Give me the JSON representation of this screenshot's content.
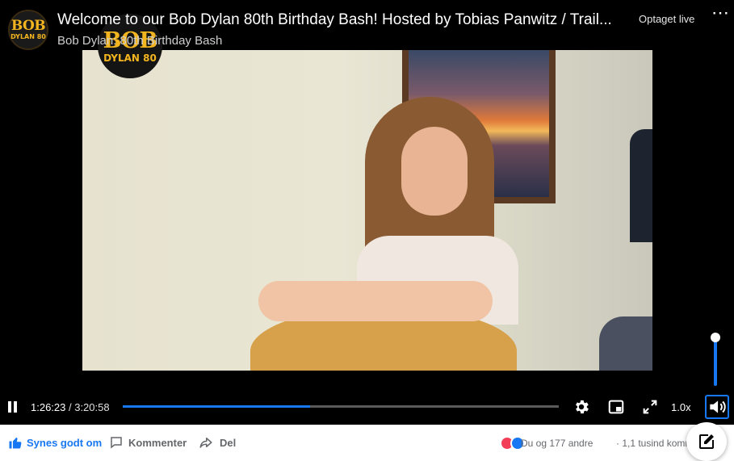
{
  "header": {
    "avatar_line1": "BOB",
    "avatar_line2": "DYLAN 80",
    "title": "Welcome to our Bob Dylan 80th Birthday Bash! Hosted by Tobias Panwitz / Trail...",
    "subtitle": "Bob Dylan: 80th Birthday Bash",
    "status": "Optaget live",
    "more_icon": "ellipsis-icon"
  },
  "video": {
    "logo_line1": "BOB",
    "logo_line2": "DYLAN 80"
  },
  "controls": {
    "current_time": "1:26:23",
    "separator": " / ",
    "duration": "3:20:58",
    "progress_fraction": 0.43,
    "volume_fraction": 1.0,
    "speed": "1.0x",
    "icons": [
      "pause-icon",
      "settings-gear-icon",
      "picture-in-picture-icon",
      "fullscreen-icon",
      "volume-icon"
    ]
  },
  "actions": {
    "like_label": "Synes godt om",
    "comment_label": "Kommenter",
    "share_label": "Del",
    "reactions_text": "Du og 177 andre",
    "comments_text": "· 1,1 tusind kommentarer"
  },
  "colors": {
    "accent": "#1877f2",
    "logo_gold": "#f2b520",
    "love": "#f33e58"
  }
}
